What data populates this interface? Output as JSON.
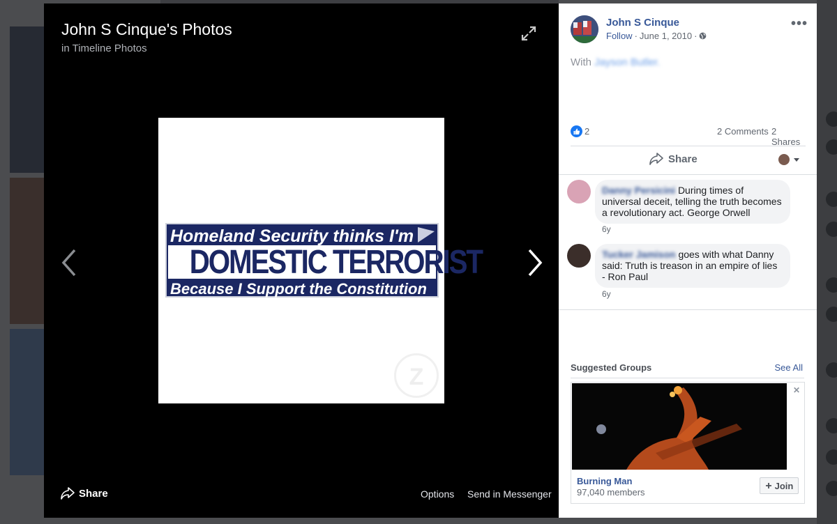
{
  "viewer": {
    "title": "John S Cinque's Photos",
    "subtitle_prefix": "in",
    "subtitle_link": "Timeline Photos",
    "sticker": {
      "line1": "Homeland Security thinks I'm",
      "line2": "DOMESTIC TERRORIST",
      "line3": "Because I Support the Constitution"
    },
    "footer": {
      "share_label": "Share",
      "options_label": "Options",
      "send_label": "Send in Messenger"
    }
  },
  "post": {
    "author": "John S Cinque",
    "follow_label": "Follow",
    "date": "June 1, 2010",
    "with_prefix": "With",
    "with_name": "Jayson Butler.",
    "likes": "2",
    "comments_label": "2 Comments",
    "shares_label": "2 Shares",
    "share_button": "Share"
  },
  "comments": [
    {
      "name": "Danny Persicini",
      "text": "During times of universal deceit, telling the truth becomes a revolutionary act. George Orwell",
      "time": "6y"
    },
    {
      "name": "Tucker Jamison",
      "text": "goes with what Danny said: Truth is treason in an empire of lies - Ron Paul",
      "time": "6y"
    }
  ],
  "suggested_groups": {
    "title": "Suggested Groups",
    "see_all": "See All",
    "group": {
      "name": "Burning Man",
      "members": "97,040 members",
      "join_label": "Join"
    }
  },
  "colors": {
    "link": "#385898",
    "like": "#1877f2",
    "sticker_navy": "#1b2763"
  },
  "icons": [
    "expand-icon",
    "chevron-left-icon",
    "chevron-right-icon",
    "share-icon",
    "globe-icon",
    "more-icon",
    "like-icon",
    "plus-icon",
    "close-icon"
  ]
}
